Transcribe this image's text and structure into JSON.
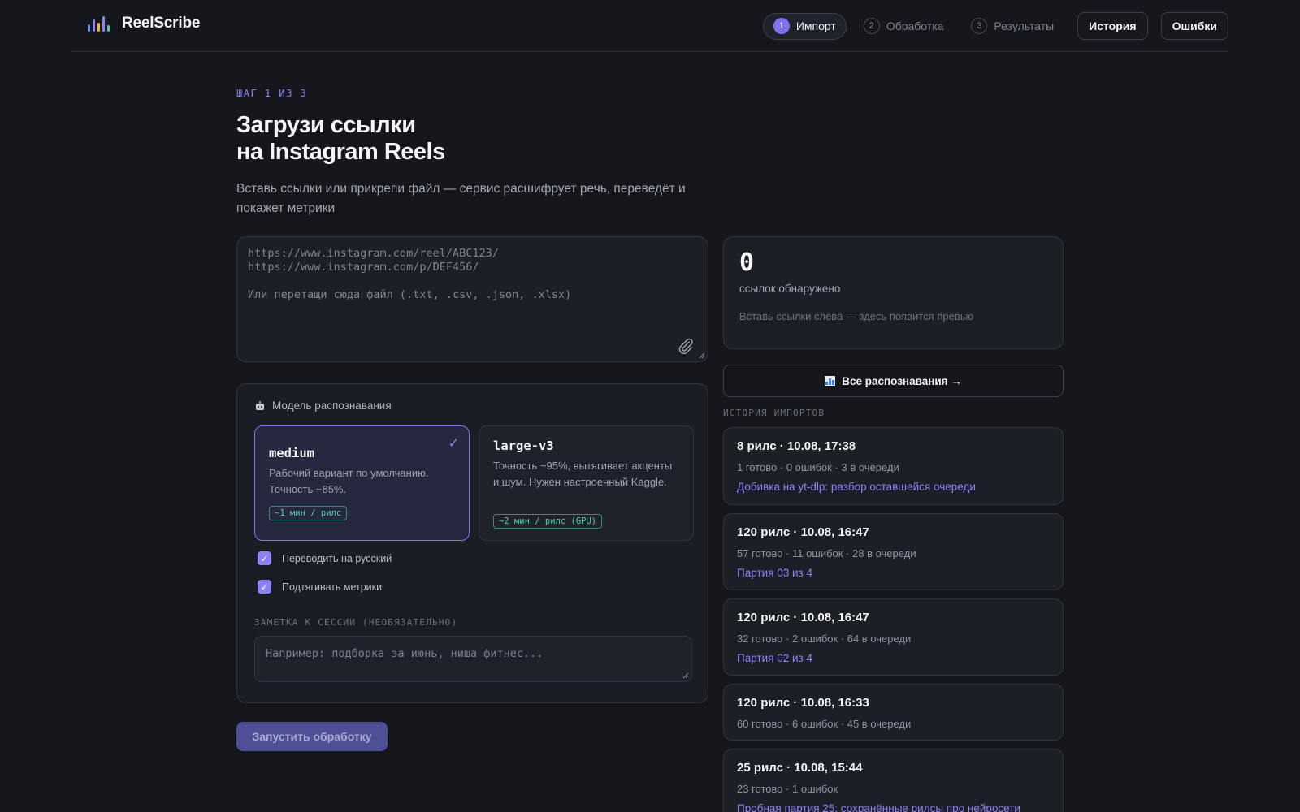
{
  "app": {
    "name": "ReelScribe",
    "logo_colors": [
      "#6c8df5",
      "#8b82f5",
      "#f0b43c",
      "#56c9a8"
    ]
  },
  "steps": [
    {
      "num": "1",
      "label": "Импорт",
      "active": true
    },
    {
      "num": "2",
      "label": "Обработка",
      "active": false
    },
    {
      "num": "3",
      "label": "Результаты",
      "active": false
    }
  ],
  "nav": {
    "history": "История",
    "errors": "Ошибки"
  },
  "hero": {
    "eyebrow": "ШАГ 1 ИЗ 3",
    "title_line1": "Загрузи ссылки",
    "title_line2": "на Instagram Reels",
    "subtitle": "Вставь ссылки или прикрепи файл — сервис расшифрует речь, переведёт и покажет метрики"
  },
  "links_input": {
    "placeholder": "https://www.instagram.com/reel/ABC123/\nhttps://www.instagram.com/p/DEF456/\n\nИли перетащи сюда файл (.txt, .csv, .json, .xlsx)"
  },
  "model": {
    "heading": "Модель распознавания",
    "options": [
      {
        "name": "medium",
        "desc": "Рабочий вариант по умолчанию. Точность ~85%.",
        "tag": "~1 мин / рилс",
        "selected": true
      },
      {
        "name": "large-v3",
        "desc": "Точность ~95%, вытягивает акценты и шум. Нужен настроенный Kaggle.",
        "tag": "~2 мин / рилс (GPU)",
        "selected": false
      }
    ],
    "checkboxes": [
      {
        "label": "Переводить на русский",
        "checked": true
      },
      {
        "label": "Подтягивать метрики",
        "checked": true
      }
    ],
    "note_label": "ЗАМЕТКА К СЕССИИ (НЕОБЯЗАТЕЛЬНО)",
    "note_placeholder": "Например: подборка за июнь, ниша фитнес..."
  },
  "run_button": "Запустить обработку",
  "summary": {
    "count": "0",
    "count_label": "ссылок обнаружено",
    "hint": "Вставь ссылки слева — здесь появится превью"
  },
  "all_button": "Все распознавания →",
  "history": {
    "label": "ИСТОРИЯ ИМПОРТОВ",
    "items": [
      {
        "title": "8 рилс · 10.08, 17:38",
        "stats": "1 готово · 0 ошибок · 3 в очереди",
        "link": "Добивка на yt-dlp: разбор оставшейся очереди"
      },
      {
        "title": "120 рилс · 10.08, 16:47",
        "stats": "57 готово · 11 ошибок · 28 в очереди",
        "link": "Партия 03 из 4"
      },
      {
        "title": "120 рилс · 10.08, 16:47",
        "stats": "32 готово · 2 ошибок · 64 в очереди",
        "link": "Партия 02 из 4"
      },
      {
        "title": "120 рилс · 10.08, 16:33",
        "stats": "60 готово · 6 ошибок · 45 в очереди",
        "link": ""
      },
      {
        "title": "25 рилс · 10.08, 15:44",
        "stats": "23 готово · 1 ошибок",
        "link": "Пробная партия 25: сохранённые рилсы про нейросети"
      }
    ]
  }
}
